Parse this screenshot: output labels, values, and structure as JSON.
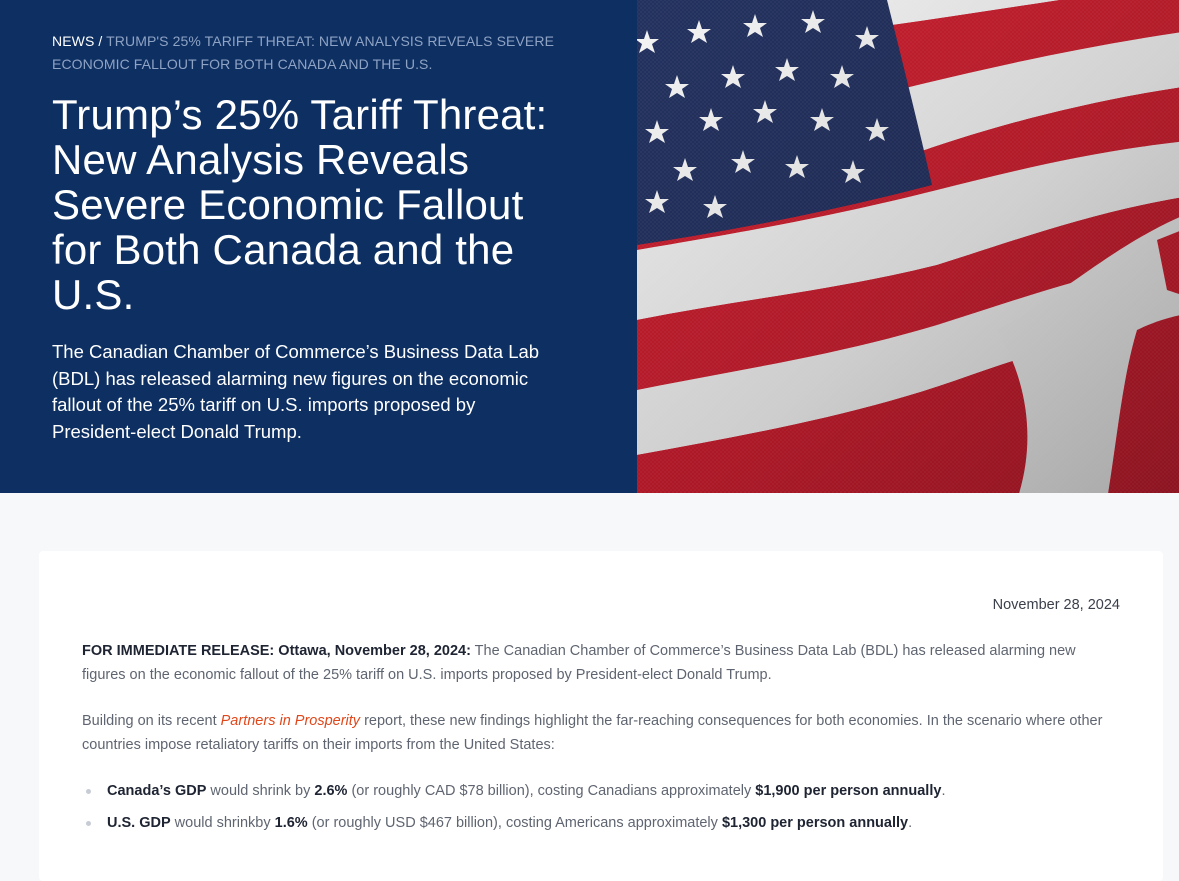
{
  "breadcrumb": {
    "news": "NEWS",
    "separator": " / ",
    "current": "TRUMP'S 25% TARIFF THREAT: NEW ANALYSIS REVEALS SEVERE ECONOMIC FALLOUT FOR BOTH CANADA AND THE U.S."
  },
  "hero": {
    "title": "Trump’s 25% Tariff Threat: New Analysis Reveals Severe Economic Fallout for Both Canada and the U.S.",
    "deck": "The Canadian Chamber of Commerce’s Business Data Lab (BDL) has released alarming new figures on the economic fallout of the 25% tariff on U.S. imports proposed by President-elect Donald Trump.",
    "image_icon": "us-canada-flags-image",
    "colors": {
      "hero_bg": "#0d2f62",
      "link_accent": "#e0471a"
    }
  },
  "article": {
    "date": "November 28, 2024",
    "intro_lead": "FOR IMMEDIATE RELEASE: Ottawa, November 28, 2024:",
    "intro_text": " The Canadian Chamber of Commerce’s Business Data Lab (BDL) has released alarming new figures on the economic fallout of the 25% tariff on U.S. imports proposed by President-elect Donald Trump.",
    "para2_before": "Building on its recent ",
    "para2_link": "Partners in Prosperity",
    "para2_after": " report, these new findings highlight the far-reaching consequences for both economies. In the scenario where other countries impose retaliatory tariffs on their imports from the United States:",
    "bullets": [
      {
        "subject": "Canada’s GDP",
        "t1": " would shrink by ",
        "pct": "2.6%",
        "t2": " (or roughly CAD $78 billion), costing Canadians approximately ",
        "amount": "$1,900 per person annually",
        "t3": "."
      },
      {
        "subject": "U.S. GDP",
        "t1": " would shrinkby ",
        "pct": "1.6%",
        "t2": " (or roughly USD $467 billion), costing Americans approximately ",
        "amount": "$1,300 per person annually",
        "t3": "."
      }
    ]
  }
}
